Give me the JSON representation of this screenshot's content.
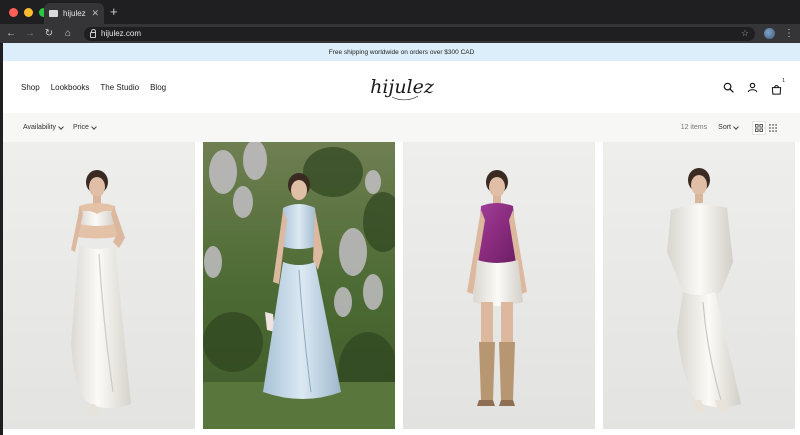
{
  "browser": {
    "tab_title": "hijulez",
    "tab_close": "✕",
    "new_tab": "+",
    "url": "hijulez.com",
    "star": "☆",
    "menu": "⋮",
    "back": "←",
    "forward": "→",
    "reload": "↻",
    "home": "⌂"
  },
  "announcement": "Free shipping worldwide on orders over $300 CAD",
  "nav": {
    "items": [
      "Shop",
      "Lookbooks",
      "The Studio",
      "Blog"
    ],
    "logo_text": "hijulez",
    "cart_count": "1"
  },
  "filters": {
    "availability": "Availability",
    "price": "Price",
    "items_count": "12 items",
    "sort": "Sort"
  },
  "products": [
    {
      "image": "model in white satin bra top and long skirt",
      "icons": "product-image-icon"
    },
    {
      "image": "model in light blue cowl top and skirt in garden",
      "icons": "product-image-icon"
    },
    {
      "image": "model in purple halter top and white mini skirt with boots",
      "icons": "product-image-icon"
    },
    {
      "image": "model in white off-shoulder top and asymmetric skirt",
      "icons": "product-image-icon"
    }
  ],
  "colors": {
    "announce_bg": "#dceefa",
    "filter_bg": "#f7f7f6",
    "purple_top": "#8a2b7e",
    "studio_bg": "#ededeb",
    "garden_green": "#4d6b34"
  }
}
